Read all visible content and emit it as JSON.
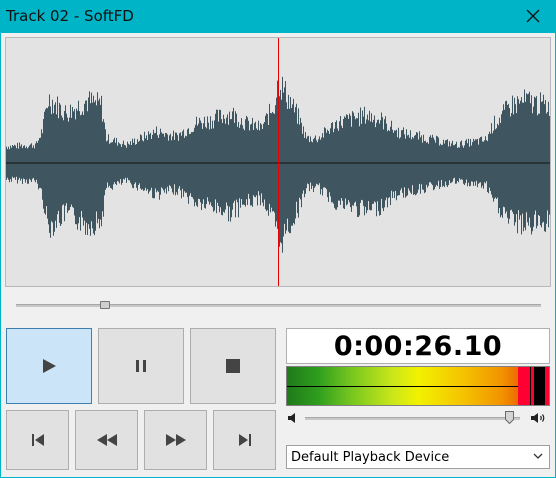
{
  "window": {
    "title": "Track 02 - SoftFD",
    "titlebar_color": "#00b4c8"
  },
  "icons": {
    "close": "close-icon",
    "play": "play-icon",
    "pause": "pause-icon",
    "stop": "stop-icon",
    "previous": "skip-previous-icon",
    "rewind": "rewind-icon",
    "fast_forward": "fast-forward-icon",
    "next": "skip-next-icon",
    "volume_low": "speaker-low-icon",
    "volume_high": "speaker-high-icon",
    "dropdown": "chevron-down-icon"
  },
  "waveform": {
    "playhead_fraction": 0.5,
    "wave_color": "#3f5660",
    "playhead_color": "#e60000",
    "background": "#e3e3e3"
  },
  "seek": {
    "position_fraction": 0.17
  },
  "controls": {
    "play_active": true
  },
  "time_display": {
    "value": "0:00:26.10"
  },
  "vu_meter": {
    "level_fraction": 0.88,
    "peak_fraction": 0.93
  },
  "volume": {
    "level_fraction": 0.95
  },
  "playback_device": {
    "selected": "Default Playback Device"
  }
}
